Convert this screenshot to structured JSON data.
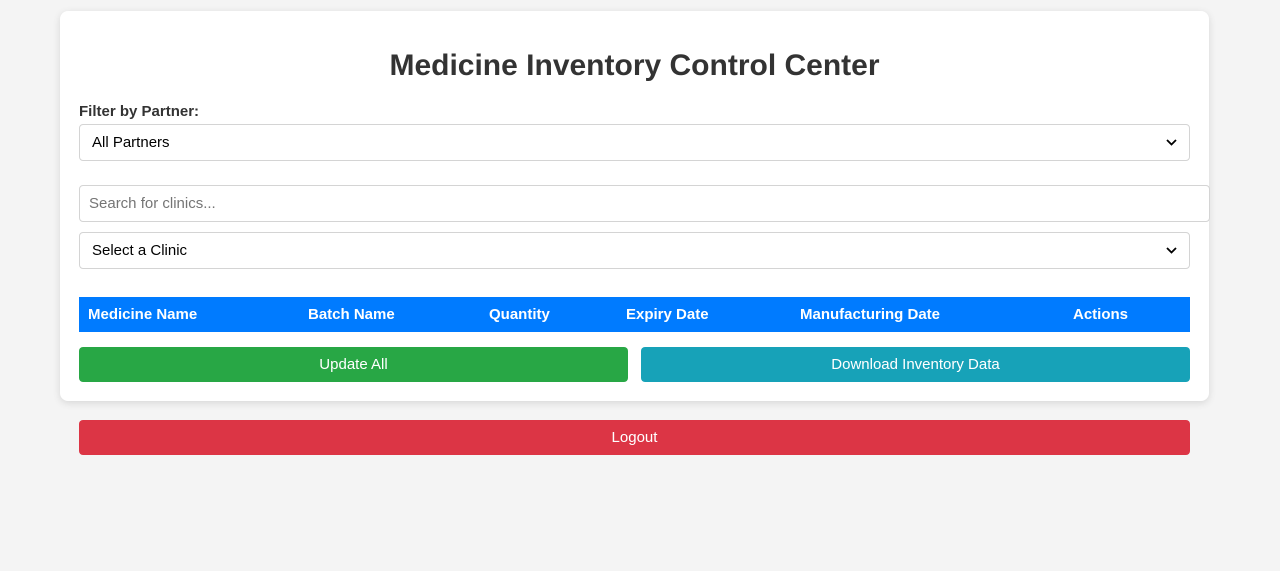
{
  "page": {
    "title": "Medicine Inventory Control Center"
  },
  "filter": {
    "label": "Filter by Partner:",
    "partner_selected": "All Partners"
  },
  "search": {
    "value": "",
    "placeholder": "Search for clinics..."
  },
  "clinic": {
    "selected": "Select a Clinic"
  },
  "table": {
    "columns": [
      "Medicine Name",
      "Batch Name",
      "Quantity",
      "Expiry Date",
      "Manufacturing Date",
      "Actions"
    ],
    "rows": []
  },
  "actions": {
    "update_all": "Update All",
    "download": "Download Inventory Data",
    "logout": "Logout"
  },
  "colors": {
    "background": "#f4f4f4",
    "header_blue": "#007bff",
    "update_green": "#28a745",
    "download_teal": "#17a2b8",
    "logout_red": "#dc3545"
  },
  "icons": {
    "select_chevron": "chevron-down-icon"
  }
}
